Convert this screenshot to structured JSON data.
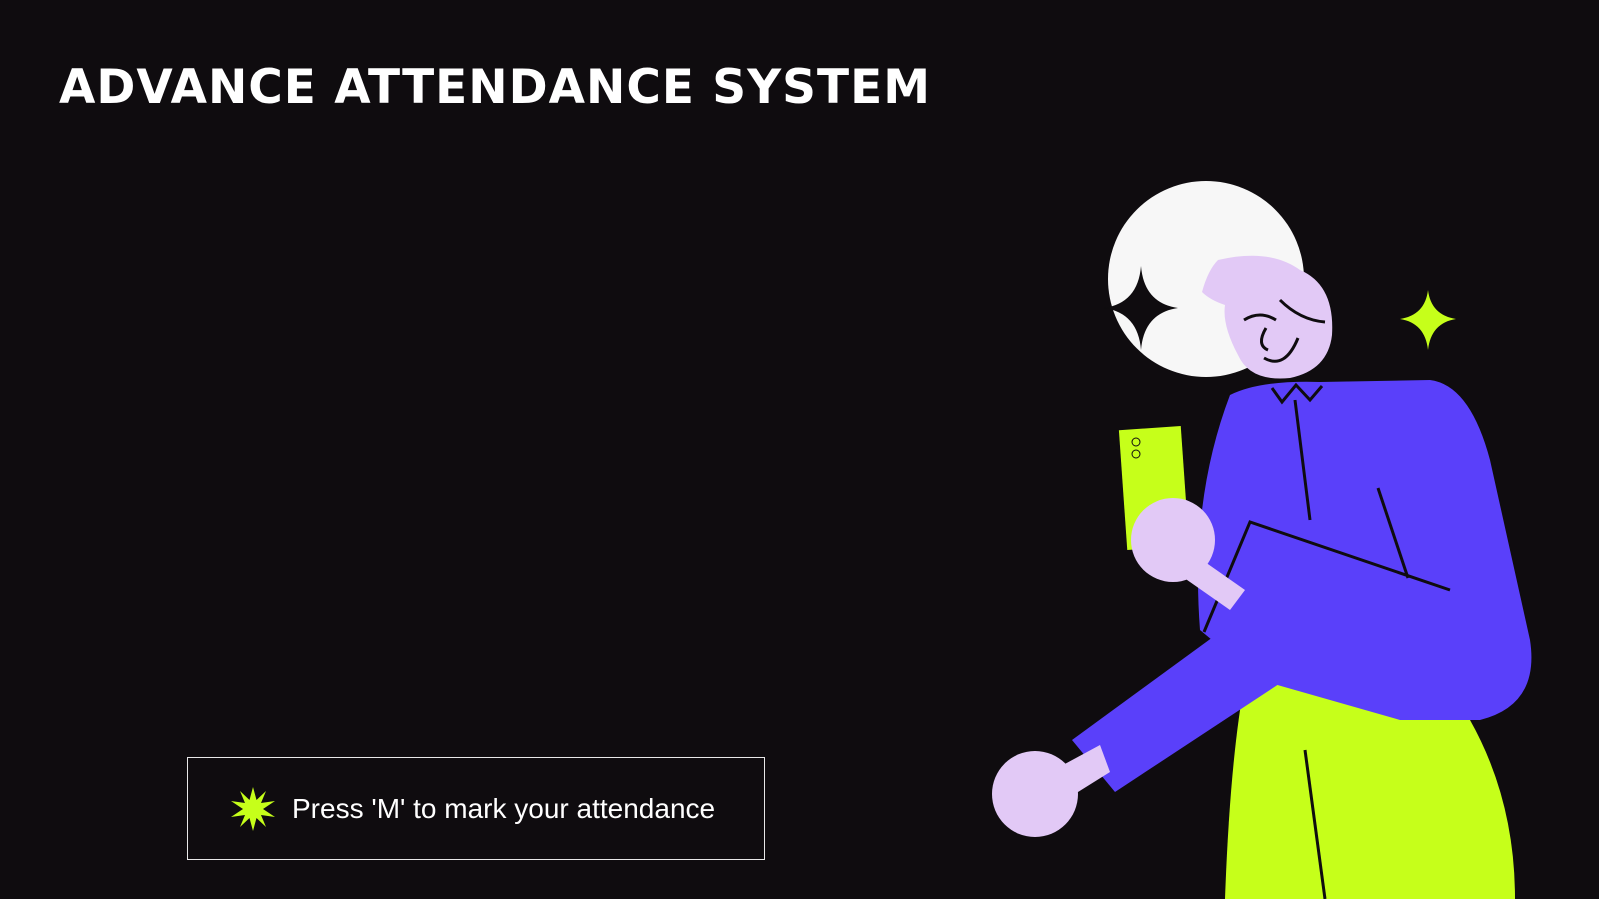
{
  "header": {
    "title": "ADVANCE ATTENDANCE SYSTEM"
  },
  "prompt": {
    "text": "Press 'M' to mark your attendance",
    "icon": "starburst-icon"
  },
  "illustration": {
    "description_icon": "person-with-phone-illustration"
  },
  "colors": {
    "background": "#0f0c0f",
    "accent_lime": "#c6ff1a",
    "shirt_purple": "#5a40fa",
    "skin_lavender": "#e2c9f6",
    "moon_white": "#f7f7f7",
    "text": "#ffffff"
  }
}
